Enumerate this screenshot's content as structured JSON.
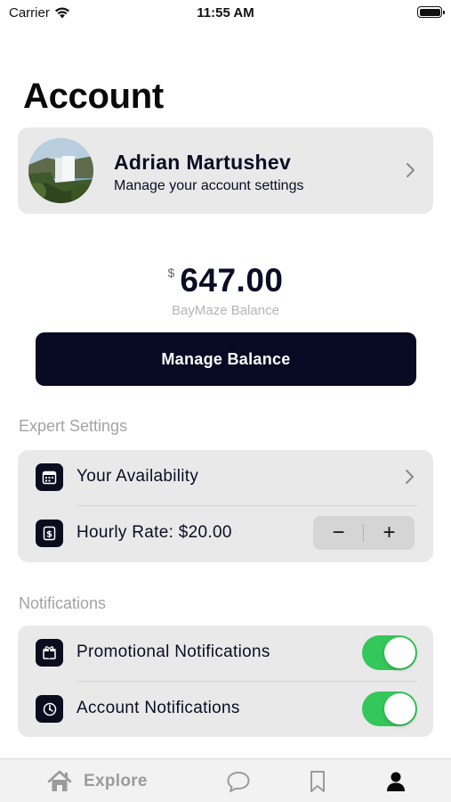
{
  "status_bar": {
    "carrier": "Carrier",
    "time": "11:55 AM"
  },
  "page": {
    "title": "Account"
  },
  "profile": {
    "name": "Adrian Martushev",
    "subtitle": "Manage your account settings"
  },
  "balance": {
    "currency": "$",
    "amount": "647.00",
    "label": "BayMaze Balance",
    "button_label": "Manage Balance"
  },
  "expert_settings": {
    "header": "Expert Settings",
    "availability_label": "Your Availability",
    "hourly_rate_label": "Hourly Rate: $20.00",
    "stepper_minus": "−",
    "stepper_plus": "+"
  },
  "notifications": {
    "header": "Notifications",
    "items": [
      {
        "label": "Promotional Notifications",
        "enabled": true,
        "icon": "gift-icon"
      },
      {
        "label": "Account Notifications",
        "enabled": true,
        "icon": "gear-icon"
      }
    ]
  },
  "tab_bar": {
    "tabs": [
      {
        "label": "Explore",
        "icon": "home-icon",
        "active": false
      },
      {
        "label": "",
        "icon": "chat-icon",
        "active": false
      },
      {
        "label": "",
        "icon": "bookmark-icon",
        "active": false
      },
      {
        "label": "",
        "icon": "person-icon",
        "active": true
      }
    ]
  },
  "colors": {
    "primary": "#080a23",
    "card_bg": "#e9e9e9",
    "toggle_on": "#34c759",
    "muted_text": "#a3a3a3"
  }
}
